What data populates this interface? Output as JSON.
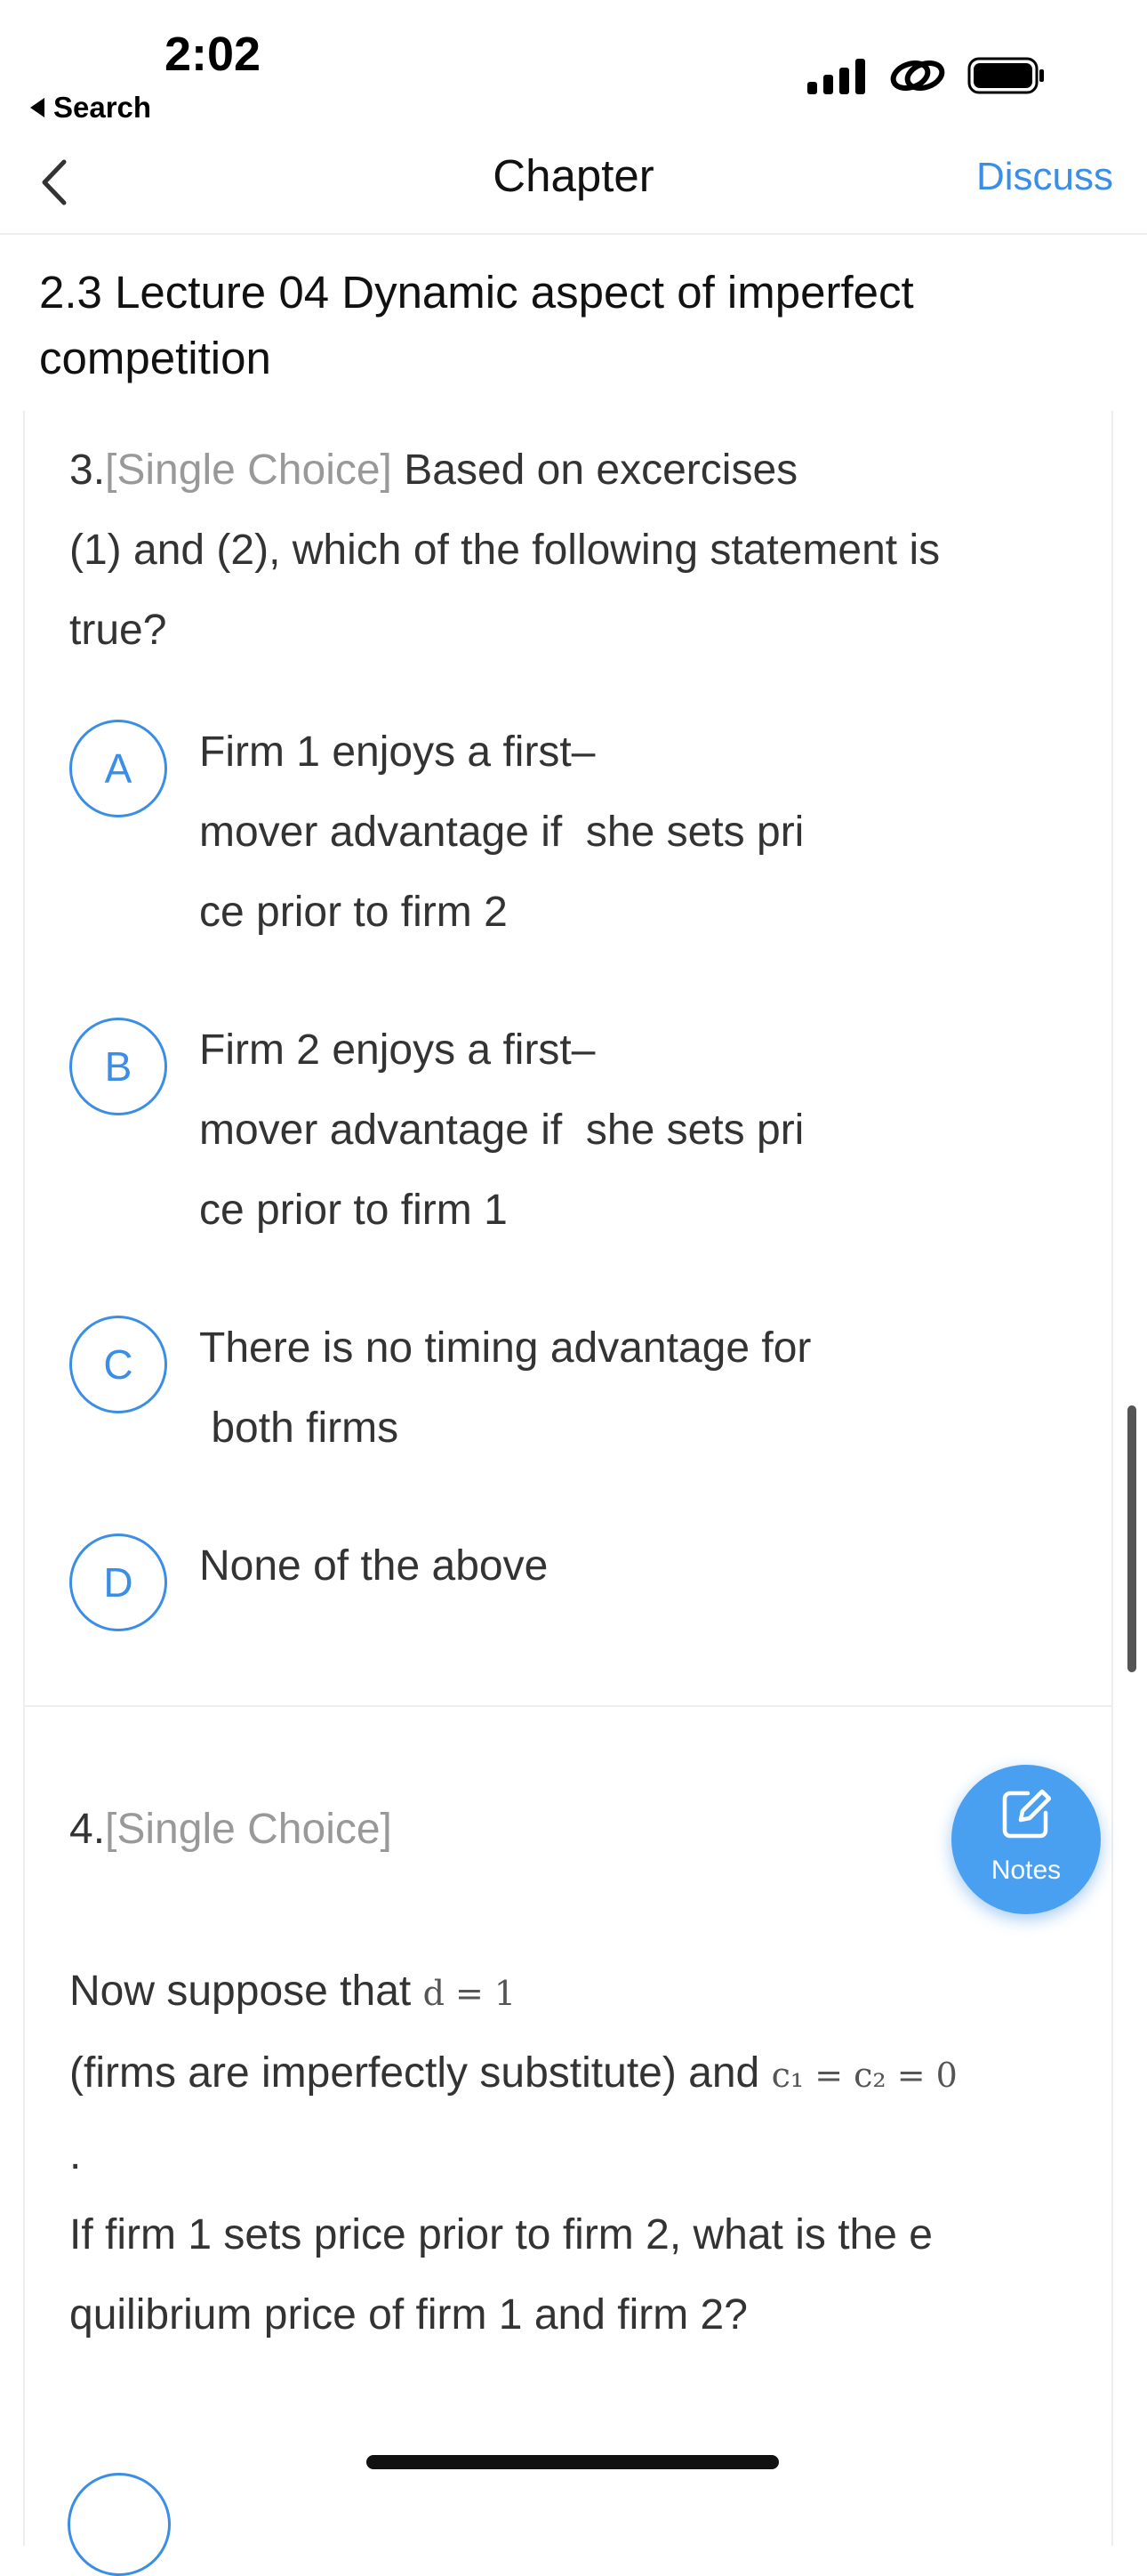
{
  "status_bar": {
    "time": "2:02",
    "back_app": "Search"
  },
  "nav": {
    "title": "Chapter",
    "discuss": "Discuss"
  },
  "chapter_title": "2.3 Lecture 04 Dynamic aspect of imperfect competition",
  "q3": {
    "number": "3.",
    "type": "[Single Choice]",
    "lines": [
      "Based on excercises",
      "(1) and (2), which of the following statement is",
      "true?"
    ],
    "options": [
      {
        "letter": "A",
        "text": "Firm 1 enjoys a first–\nmover advantage if  she sets pri\nce prior to firm 2"
      },
      {
        "letter": "B",
        "text": "Firm 2 enjoys a first–\nmover advantage if  she sets pri\nce prior to firm 1"
      },
      {
        "letter": "C",
        "text": "There is no timing advantage for\n both firms"
      },
      {
        "letter": "D",
        "text": "None of the above"
      }
    ]
  },
  "q4": {
    "number": "4.",
    "type": "[Single Choice]",
    "line1": "Now suppose that",
    "math1": "d = 1",
    "line2": " (firms are imperfectly substitute) and",
    "math2": "c₁ = c₂ = 0",
    "line3": ".",
    "line4": "If firm 1 sets price prior to firm 2, what is the e",
    "line5": "quilibrium price of firm 1 and firm 2?"
  },
  "notes_button": {
    "label": "Notes",
    "icon": "edit-icon"
  },
  "colors": {
    "accent": "#3a8ee6",
    "muted": "#999999"
  }
}
